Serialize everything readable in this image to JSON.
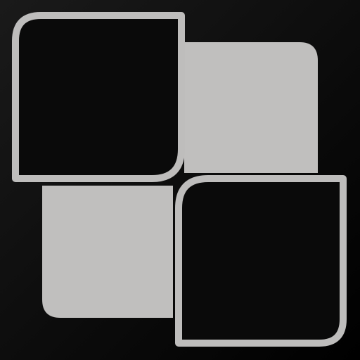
{
  "icon": {
    "name": "overlapping-squares-logo",
    "colors": {
      "background_top": "#1a1a1a",
      "background_bottom": "#000000",
      "tile_fill": "#c0bfbe",
      "outline_stroke": "#bebdbc",
      "outline_inner": "#0a0a0a"
    }
  }
}
